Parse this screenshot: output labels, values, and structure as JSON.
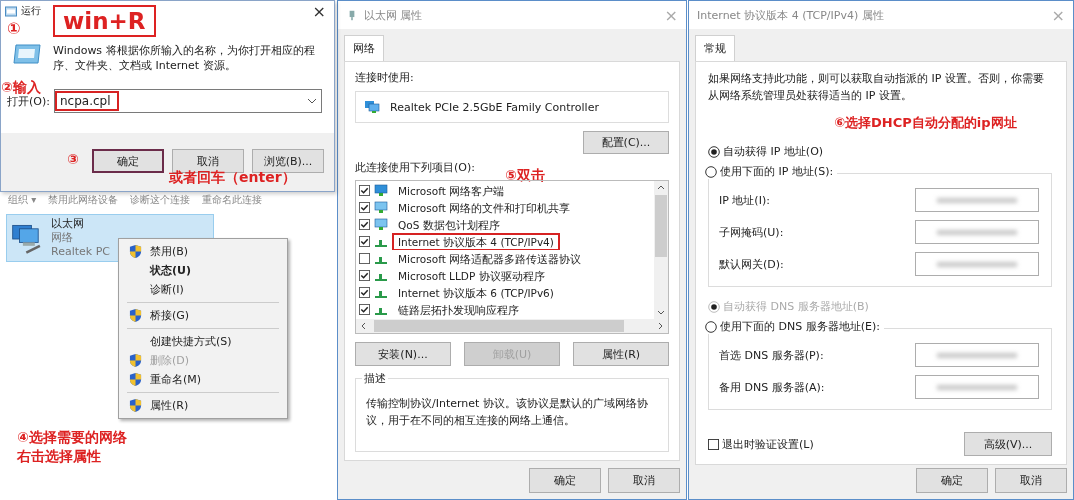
{
  "run_dialog": {
    "title": "运行",
    "close": "×",
    "step1": {
      "number": "①",
      "text": "win+R"
    },
    "description": "Windows 将根据你所输入的名称，为你打开相应的程序、文件夹、文档或 Internet 资源。",
    "step2": "②输入",
    "open_label": "打开(O):",
    "open_value": "ncpa.cpl",
    "open_highlighted": true,
    "step3": "③",
    "buttons": [
      {
        "label": "确定",
        "highlighted": true
      },
      {
        "label": "取消",
        "highlighted": false
      },
      {
        "label": "浏览(B)...",
        "highlighted": false
      }
    ],
    "enter_note": "或者回车（enter）"
  },
  "explorer": {
    "toolbar": [
      "组织 ▾",
      "禁用此网络设备",
      "诊断这个连接",
      "重命名此连接"
    ],
    "adapter": {
      "name": "以太网",
      "status": "网络",
      "device": "Realtek PC",
      "selected": true
    },
    "step4": [
      "④选择需要的网络",
      "右击选择属性"
    ]
  },
  "context_menu": [
    {
      "kind": "item",
      "label": "禁用(B)",
      "shield": true,
      "bold": false,
      "disabled": false
    },
    {
      "kind": "item",
      "label": "状态(U)",
      "shield": false,
      "bold": true,
      "disabled": false
    },
    {
      "kind": "item",
      "label": "诊断(I)",
      "shield": false,
      "bold": false,
      "disabled": false
    },
    {
      "kind": "separator"
    },
    {
      "kind": "item",
      "label": "桥接(G)",
      "shield": true,
      "bold": false,
      "disabled": false
    },
    {
      "kind": "separator"
    },
    {
      "kind": "item",
      "label": "创建快捷方式(S)",
      "shield": false,
      "bold": false,
      "disabled": false
    },
    {
      "kind": "item",
      "label": "删除(D)",
      "shield": true,
      "bold": false,
      "disabled": true
    },
    {
      "kind": "item",
      "label": "重命名(M)",
      "shield": true,
      "bold": false,
      "disabled": false
    },
    {
      "kind": "separator"
    },
    {
      "kind": "item",
      "label": "属性(R)",
      "shield": true,
      "bold": false,
      "disabled": false
    }
  ],
  "ethernet_properties": {
    "title": "以太网 属性",
    "close": "×",
    "tabs": [
      {
        "label": "网络",
        "selected": true
      }
    ],
    "connect_using_label": "连接时使用:",
    "adapter": "Realtek PCIe 2.5GbE Family Controller",
    "configure_button": "配置(C)...",
    "items_label": "此连接使用下列项目(O):",
    "step5": "⑤双击",
    "items": [
      {
        "kind": "client",
        "label": "Microsoft 网络客户端",
        "checked": true,
        "highlighted": false
      },
      {
        "kind": "service",
        "label": "Microsoft 网络的文件和打印机共享",
        "checked": true,
        "highlighted": false
      },
      {
        "kind": "service",
        "label": "QoS 数据包计划程序",
        "checked": true,
        "highlighted": false
      },
      {
        "kind": "protocol",
        "label": "Internet 协议版本 4 (TCP/IPv4)",
        "checked": true,
        "highlighted": true
      },
      {
        "kind": "protocol",
        "label": "Microsoft 网络适配器多路传送器协议",
        "checked": false,
        "highlighted": false
      },
      {
        "kind": "protocol",
        "label": "Microsoft LLDP 协议驱动程序",
        "checked": true,
        "highlighted": false
      },
      {
        "kind": "protocol",
        "label": "Internet 协议版本 6 (TCP/IPv6)",
        "checked": true,
        "highlighted": false
      },
      {
        "kind": "protocol",
        "label": "链路层拓扑发现响应程序",
        "checked": true,
        "highlighted": false
      }
    ],
    "buttons": [
      {
        "label": "安装(N)...",
        "disabled": false
      },
      {
        "label": "卸载(U)",
        "disabled": true
      },
      {
        "label": "属性(R)",
        "disabled": false
      }
    ],
    "description_title": "描述",
    "description": "传输控制协议/Internet 协议。该协议是默认的广域网络协议，用于在不同的相互连接的网络上通信。",
    "footer_buttons": [
      "确定",
      "取消"
    ]
  },
  "ipv4_properties": {
    "title": "Internet 协议版本 4 (TCP/IPv4) 属性",
    "close": "×",
    "tabs": [
      {
        "label": "常规",
        "selected": true
      }
    ],
    "intro": "如果网络支持此功能，则可以获取自动指派的 IP 设置。否则，你需要从网络系统管理员处获得适当的 IP 设置。",
    "step6": "⑥选择DHCP自动分配的ip网址",
    "ip_options": [
      {
        "label": "自动获得 IP 地址(O)",
        "selected": true,
        "disabled": false
      },
      {
        "label": "使用下面的 IP 地址(S):",
        "selected": false,
        "disabled": false
      }
    ],
    "ip_fields": [
      "IP 地址(I):",
      "子网掩码(U):",
      "默认网关(D):"
    ],
    "dns_options": [
      {
        "label": "自动获得 DNS 服务器地址(B)",
        "selected": true,
        "disabled": true
      },
      {
        "label": "使用下面的 DNS 服务器地址(E):",
        "selected": false,
        "disabled": false
      }
    ],
    "dns_fields": [
      "首选 DNS 服务器(P):",
      "备用 DNS 服务器(A):"
    ],
    "validate": {
      "label": "退出时验证设置(L)",
      "checked": false
    },
    "advanced_button": "高级(V)...",
    "footer_buttons": [
      "确定",
      "取消"
    ]
  }
}
